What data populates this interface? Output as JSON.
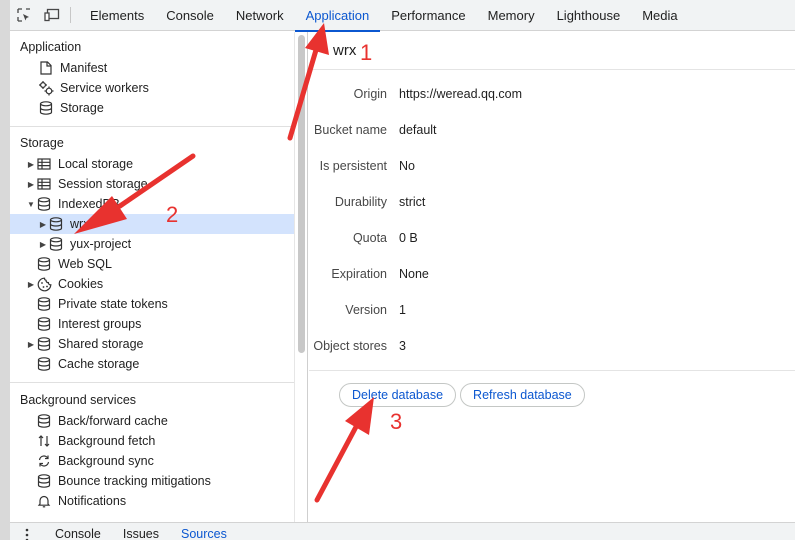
{
  "toolbar": {
    "inspect_icon": "element-picker-icon",
    "device_icon": "device-toolbar-icon",
    "tabs": [
      {
        "label": "Elements"
      },
      {
        "label": "Console"
      },
      {
        "label": "Network"
      },
      {
        "label": "Application",
        "active": true
      },
      {
        "label": "Performance"
      },
      {
        "label": "Memory"
      },
      {
        "label": "Lighthouse"
      },
      {
        "label": "Media"
      }
    ]
  },
  "sidebar": {
    "application": {
      "title": "Application",
      "items": [
        {
          "label": "Manifest",
          "icon": "document-icon"
        },
        {
          "label": "Service workers",
          "icon": "gears-icon"
        },
        {
          "label": "Storage",
          "icon": "database-icon"
        }
      ]
    },
    "storage": {
      "title": "Storage",
      "local_storage": "Local storage",
      "session_storage": "Session storage",
      "indexeddb": "IndexedDB",
      "db_wrx": "wrx",
      "db_yux": "yux-project",
      "web_sql": "Web SQL",
      "cookies": "Cookies",
      "private_state_tokens": "Private state tokens",
      "interest_groups": "Interest groups",
      "shared_storage": "Shared storage",
      "cache_storage": "Cache storage"
    },
    "background": {
      "title": "Background services",
      "items": [
        {
          "label": "Back/forward cache",
          "icon": "database-icon"
        },
        {
          "label": "Background fetch",
          "icon": "fetch-arrows-icon"
        },
        {
          "label": "Background sync",
          "icon": "sync-icon"
        },
        {
          "label": "Bounce tracking mitigations",
          "icon": "database-icon"
        },
        {
          "label": "Notifications",
          "icon": "bell-icon"
        }
      ]
    }
  },
  "main": {
    "db_name": "wrx",
    "properties": [
      {
        "key": "Origin",
        "value": "https://weread.qq.com"
      },
      {
        "key": "Bucket name",
        "value": "default"
      },
      {
        "key": "Is persistent",
        "value": "No"
      },
      {
        "key": "Durability",
        "value": "strict"
      },
      {
        "key": "Quota",
        "value": "0 B"
      },
      {
        "key": "Expiration",
        "value": "None"
      },
      {
        "key": "Version",
        "value": "1"
      },
      {
        "key": "Object stores",
        "value": "3"
      }
    ],
    "delete_label": "Delete database",
    "refresh_label": "Refresh database"
  },
  "drawer": {
    "menu_icon": "kebab-menu-icon",
    "tabs": [
      {
        "label": "Console"
      },
      {
        "label": "Issues"
      },
      {
        "label": "Sources",
        "active": true
      }
    ]
  },
  "annotations": {
    "color": "#e8322f",
    "labels": [
      "1",
      "2",
      "3"
    ]
  },
  "colors": {
    "accent": "#0b57d0",
    "selected_bg": "#d3e3fd",
    "tabbar_bg": "#f1f3f4"
  }
}
